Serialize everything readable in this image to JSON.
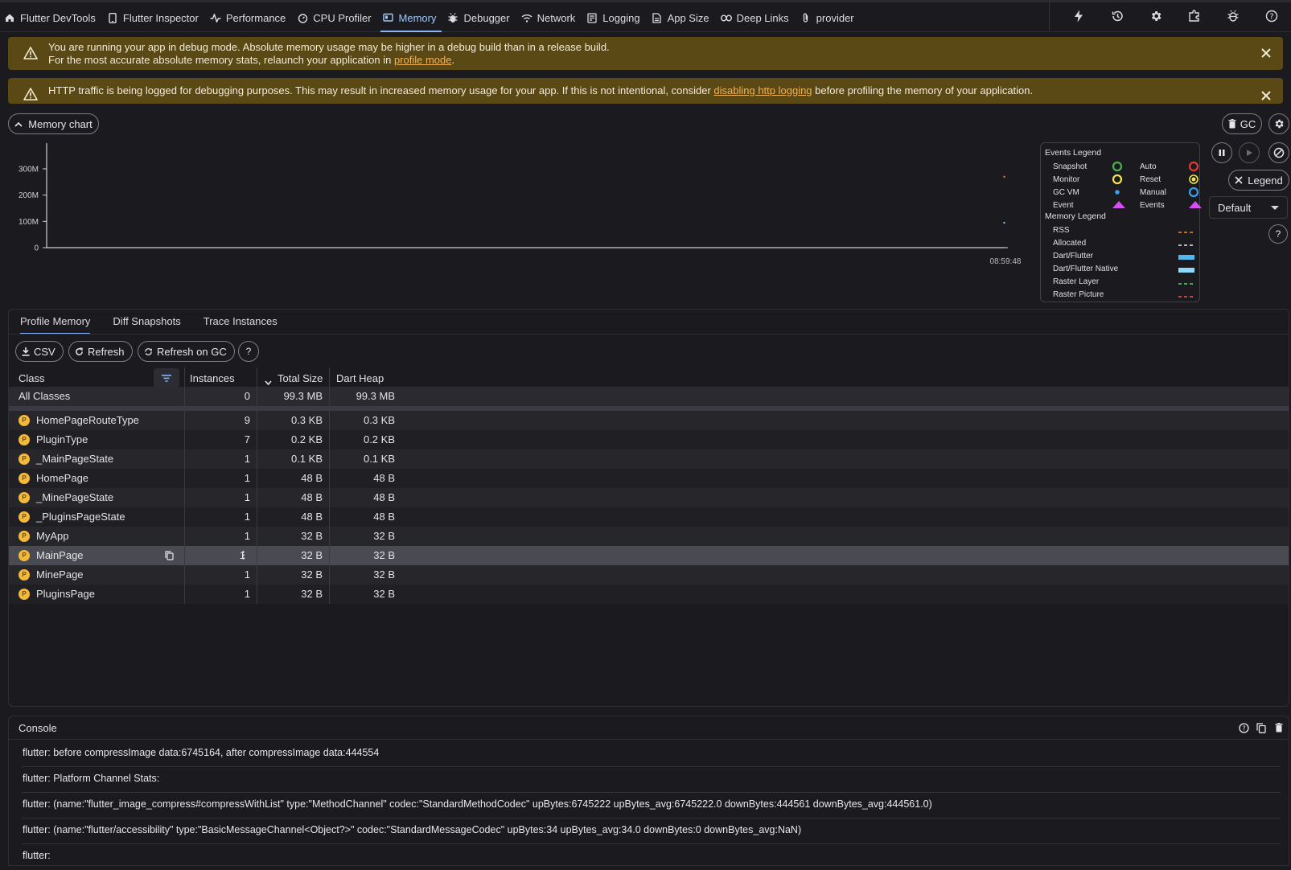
{
  "nav": {
    "tabs": [
      {
        "label": "Flutter DevTools",
        "icon": "home-icon"
      },
      {
        "label": "Flutter Inspector",
        "icon": "phone-icon"
      },
      {
        "label": "Performance",
        "icon": "pulse-icon"
      },
      {
        "label": "CPU Profiler",
        "icon": "timer-icon"
      },
      {
        "label": "Memory",
        "icon": "memory-icon",
        "active": true
      },
      {
        "label": "Debugger",
        "icon": "bug-icon"
      },
      {
        "label": "Network",
        "icon": "wifi-icon"
      },
      {
        "label": "Logging",
        "icon": "log-icon"
      },
      {
        "label": "App Size",
        "icon": "file-icon"
      },
      {
        "label": "Deep Links",
        "icon": "link-icon"
      },
      {
        "label": "provider",
        "icon": "clip-icon"
      }
    ],
    "actions": [
      "bolt-icon",
      "history-icon",
      "gear-icon",
      "extension-icon",
      "bug-settings-icon",
      "help-icon"
    ]
  },
  "banners": {
    "debug": {
      "line1": "You are running your app in debug mode. Absolute memory usage may be higher in a debug build than in a release build.",
      "line2_prefix": "For the most accurate absolute memory stats, relaunch your application in ",
      "line2_link": "profile mode",
      "line2_suffix": "."
    },
    "http": {
      "prefix": "HTTP traffic is being logged for debugging purposes. This may result in increased memory usage for your app. If this is not intentional, consider ",
      "link": "disabling http logging",
      "suffix": " before profiling the memory of your application."
    }
  },
  "chart_controls": {
    "memory_chart_label": "Memory chart",
    "gc_label": "GC",
    "legend_label": "Legend",
    "dropdown_value": "Default"
  },
  "chart_data": {
    "type": "line",
    "y_ticks": [
      "0",
      "100M",
      "200M",
      "300M"
    ],
    "ylim": [
      0,
      300
    ],
    "x_tick": "08:59:48",
    "points": [
      {
        "series": "RSS",
        "x": "08:59:48",
        "y": 270
      },
      {
        "series": "Allocated",
        "x": "08:59:48",
        "y": 95
      }
    ]
  },
  "legend": {
    "events_title": "Events Legend",
    "events": [
      {
        "label": "Snapshot",
        "color": "#4caf50",
        "kind": "ring"
      },
      {
        "label": "Auto",
        "color": "#e53935",
        "kind": "ring"
      },
      {
        "label": "Monitor",
        "color": "#f4e44c",
        "kind": "ring"
      },
      {
        "label": "Reset",
        "color": "#f4e44c",
        "kind": "dotring"
      },
      {
        "label": "GC VM",
        "color": "#3d9df0",
        "kind": "dot"
      },
      {
        "label": "Manual",
        "color": "#3d9df0",
        "kind": "ring"
      },
      {
        "label": "Event",
        "color": "#d44ff0",
        "kind": "tri"
      },
      {
        "label": "Events",
        "color": "#d44ff0",
        "kind": "tri"
      }
    ],
    "memory_title": "Memory Legend",
    "memory": [
      {
        "label": "RSS",
        "color": "#f08a3c",
        "kind": "dash"
      },
      {
        "label": "Allocated",
        "color": "#e8e8ec",
        "kind": "dash"
      },
      {
        "label": "Dart/Flutter",
        "color": "#4fb8ec",
        "kind": "solid"
      },
      {
        "label": "Dart/Flutter Native",
        "color": "#8fd8fa",
        "kind": "solid"
      },
      {
        "label": "Raster Layer",
        "color": "#55d67a",
        "kind": "dash"
      },
      {
        "label": "Raster Picture",
        "color": "#f05a5a",
        "kind": "dash"
      }
    ]
  },
  "profile": {
    "tabs": [
      "Profile Memory",
      "Diff Snapshots",
      "Trace Instances"
    ],
    "toolbar": {
      "csv": "CSV",
      "refresh": "Refresh",
      "refresh_gc": "Refresh on GC"
    },
    "columns": {
      "class": "Class",
      "instances": "Instances",
      "total_size": "Total Size",
      "dart_heap": "Dart Heap"
    },
    "all_classes": {
      "name": "All Classes",
      "instances": "0",
      "total": "99.3 MB",
      "heap": "99.3 MB"
    },
    "badge_letter": "P",
    "rows": [
      {
        "name": "HomePageRouteType",
        "instances": "9",
        "total": "0.3 KB",
        "heap": "0.3 KB"
      },
      {
        "name": "PluginType",
        "instances": "7",
        "total": "0.2 KB",
        "heap": "0.2 KB"
      },
      {
        "name": "_MainPageState",
        "instances": "1",
        "total": "0.1 KB",
        "heap": "0.1 KB"
      },
      {
        "name": "HomePage",
        "instances": "1",
        "total": "48 B",
        "heap": "48 B"
      },
      {
        "name": "_MinePageState",
        "instances": "1",
        "total": "48 B",
        "heap": "48 B"
      },
      {
        "name": "_PluginsPageState",
        "instances": "1",
        "total": "48 B",
        "heap": "48 B"
      },
      {
        "name": "MyApp",
        "instances": "1",
        "total": "32 B",
        "heap": "32 B"
      },
      {
        "name": "MainPage",
        "instances": "1",
        "total": "32 B",
        "heap": "32 B",
        "selected": true
      },
      {
        "name": "MinePage",
        "instances": "1",
        "total": "32 B",
        "heap": "32 B"
      },
      {
        "name": "PluginsPage",
        "instances": "1",
        "total": "32 B",
        "heap": "32 B"
      }
    ]
  },
  "console": {
    "title": "Console",
    "lines": [
      "flutter: before compressImage data:6745164, after compressImage data:444554",
      "flutter: Platform Channel Stats:",
      "flutter:   (name:\"flutter_image_compress#compressWithList\" type:\"MethodChannel\" codec:\"StandardMethodCodec\" upBytes:6745222 upBytes_avg:6745222.0 downBytes:444561 downBytes_avg:444561.0)",
      "flutter:   (name:\"flutter/accessibility\" type:\"BasicMessageChannel<Object?>\" codec:\"StandardMessageCodec\" upBytes:34 upBytes_avg:34.0 downBytes:0 downBytes_avg:NaN)",
      "flutter:"
    ]
  }
}
